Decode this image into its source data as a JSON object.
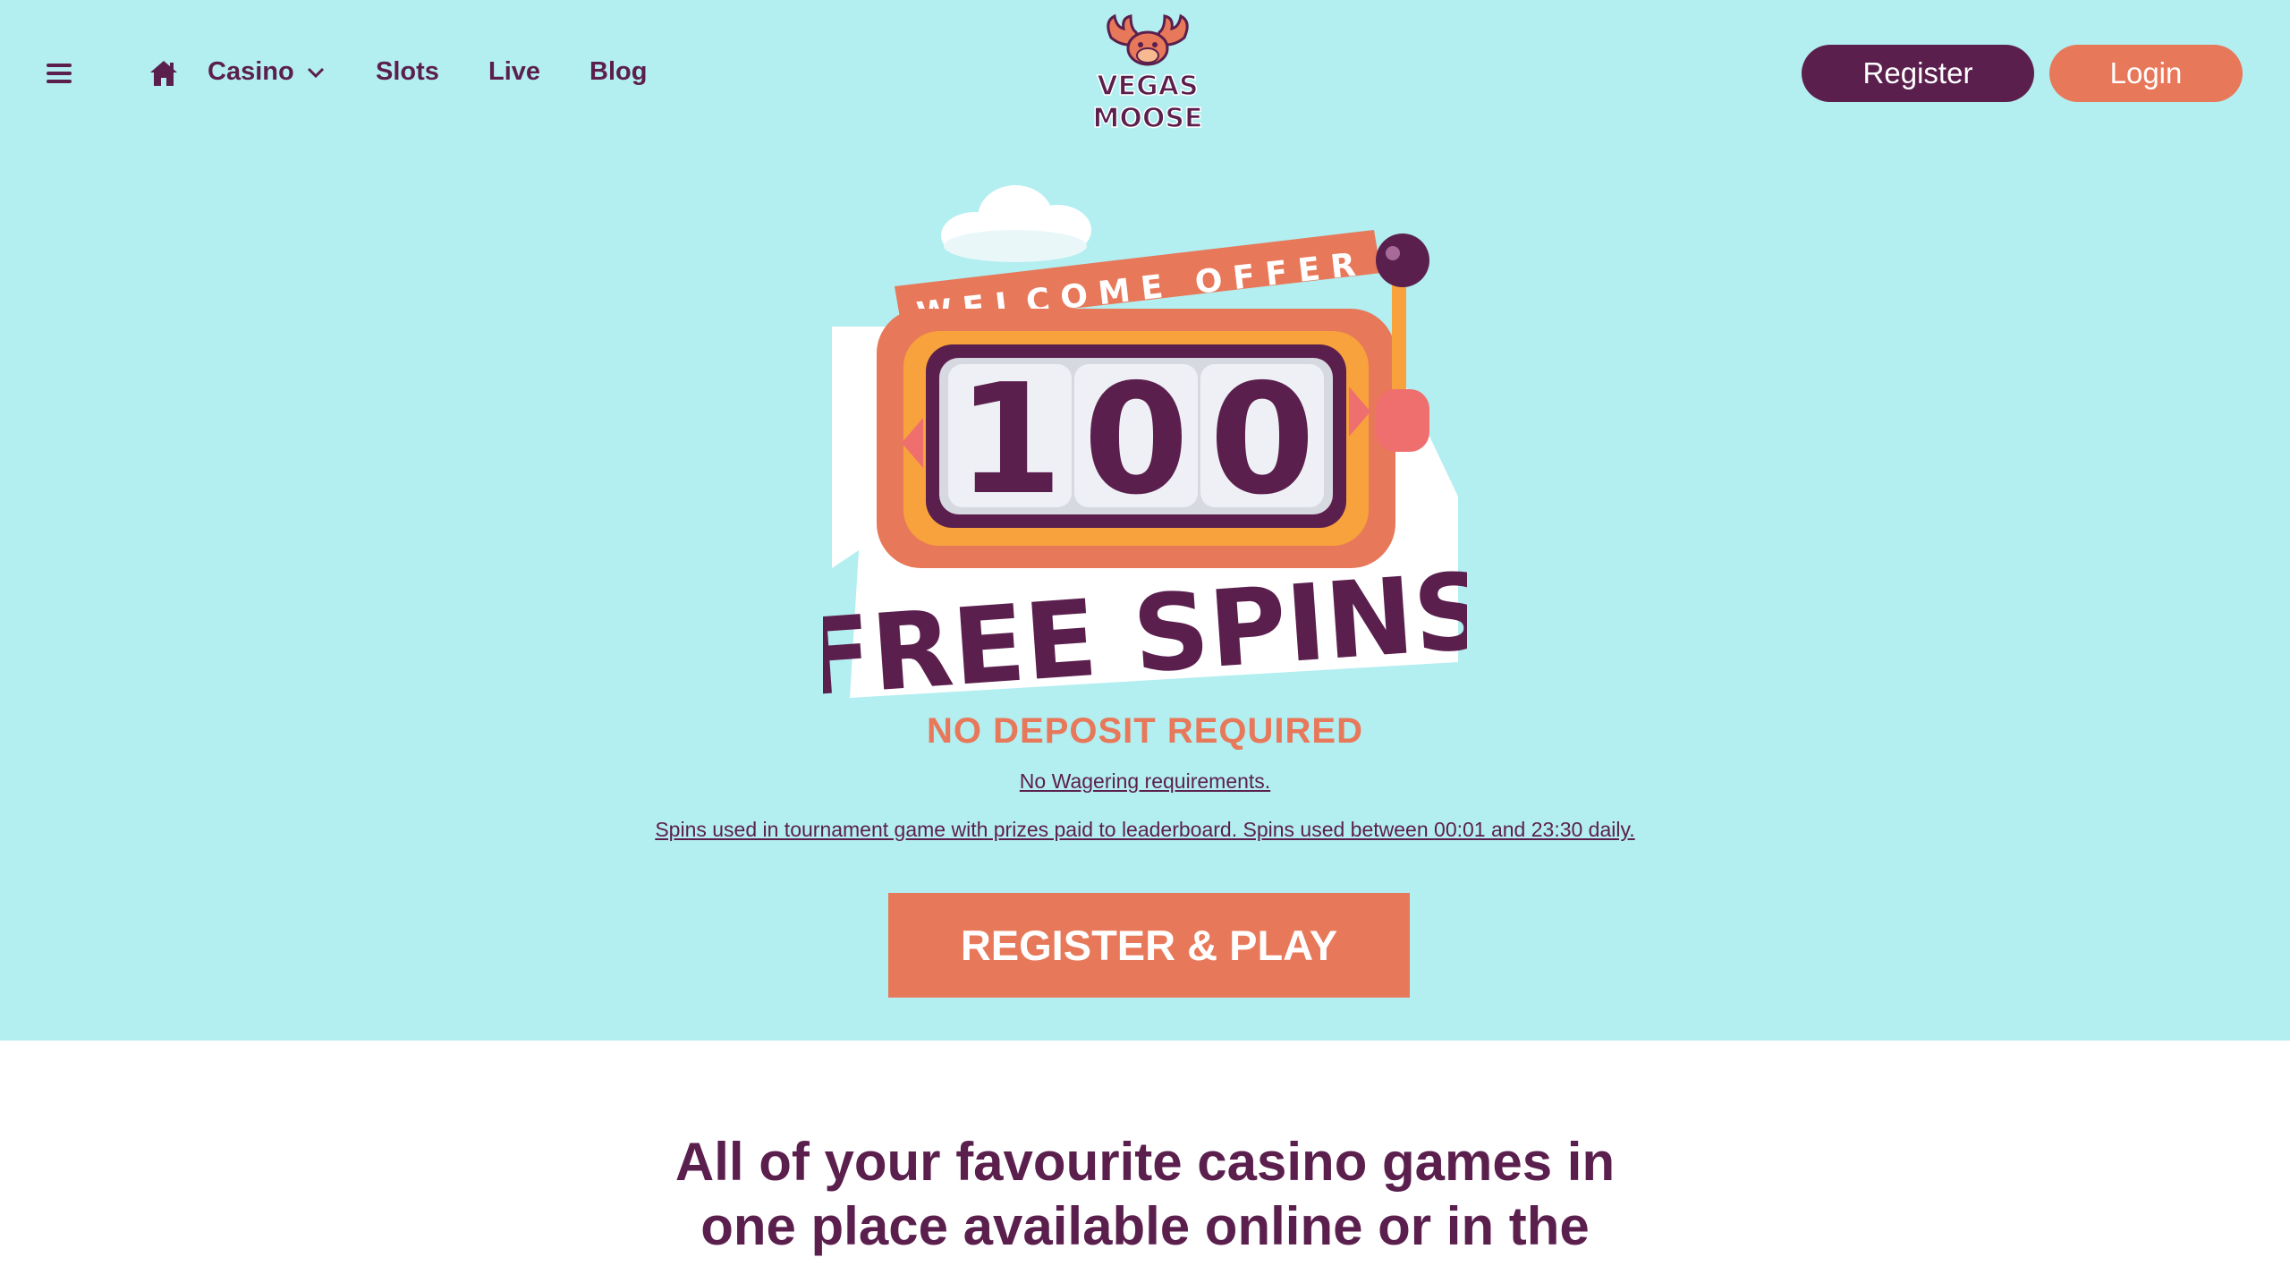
{
  "header": {
    "menu_icon": "hamburger-menu-icon",
    "home_icon": "home-icon",
    "nav": {
      "casino": "Casino",
      "slots": "Slots",
      "live": "Live",
      "blog": "Blog"
    },
    "logo": {
      "line1": "VEGAS",
      "line2": "MOOSE"
    },
    "register_label": "Register",
    "login_label": "Login"
  },
  "hero": {
    "banner_top": "WELCOME OFFER",
    "reel_digits": [
      "1",
      "0",
      "0"
    ],
    "banner_bottom": "FREE SPINS",
    "no_deposit": "NO DEPOSIT REQUIRED",
    "terms_line1": "No Wagering requirements.",
    "terms_line2": "Spins used in tournament game with prizes paid to leaderboard. Spins used between 00:01 and 23:30 daily.",
    "cta_label": "REGISTER & PLAY"
  },
  "intro": {
    "line1": "All of your favourite casino games in",
    "line2": "one place available online or in the"
  },
  "colors": {
    "background": "#b3eef0",
    "primary": "#5b1f4e",
    "accent": "#e8785a",
    "section_bg": "#ffffff"
  }
}
